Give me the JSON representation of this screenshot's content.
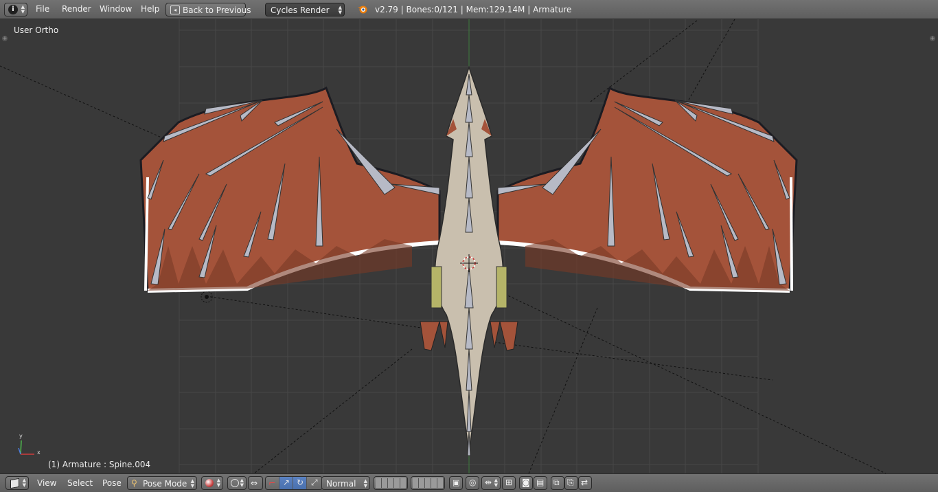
{
  "header": {
    "menus": [
      "File",
      "Render",
      "Window",
      "Help"
    ],
    "back_button": "Back to Previous",
    "render_engine": "Cycles Render",
    "stats": "v2.79 | Bones:0/121  | Mem:129.14M | Armature"
  },
  "viewport": {
    "view_name": "User Ortho",
    "object_info": "(1) Armature : Spine.004",
    "axis_x": "x",
    "axis_y": "y"
  },
  "footer": {
    "menus": [
      "View",
      "Select",
      "Pose"
    ],
    "mode": "Pose Mode",
    "orientation": "Normal"
  },
  "colors": {
    "header_bg": "#666666",
    "viewport_bg": "#393939",
    "grid": "#4a4a4a",
    "wing": "#a8553a",
    "bone": "#b8bcc8",
    "active": "#5a82c2"
  },
  "icons": [
    "info-icon",
    "back-icon",
    "blender-logo-icon",
    "cube-icon",
    "pose-mode-icon",
    "shading-sphere-icon",
    "pivot-icon",
    "manipulator-icon",
    "layers-icon",
    "lock-icon",
    "render-icon",
    "copy-pose-icon"
  ]
}
